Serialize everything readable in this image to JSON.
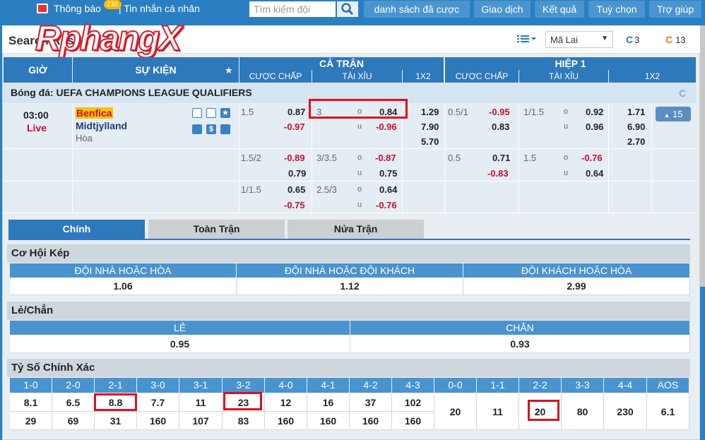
{
  "topbar": {
    "notif_label": "Thông báo",
    "notif_count": "236",
    "msg_label": "| Tin nhắn cá nhân",
    "search_placeholder": "Tìm kiếm đội",
    "buttons": [
      "danh sách đã cược",
      "Giao dịch",
      "Kết quả",
      "Tuỳ chọn",
      "Trợ giúp"
    ]
  },
  "toolbar": {
    "title": "Search Result",
    "logo": "RphangX",
    "odds_type": "Mã Lai",
    "count_a": "3",
    "count_b": "13"
  },
  "header": {
    "gio": "GIỜ",
    "su_kien": "SỰ KIỆN",
    "ca_tran": "CẢ TRẬN",
    "hiep1": "HIỆP 1",
    "cuoc_chap": "CƯỢC CHẤP",
    "tai_xiu": "TÀI XỈU",
    "x12": "1X2"
  },
  "league": "Bóng đá: UEFA CHAMPIONS LEAGUE QUALIFIERS",
  "match": {
    "time": "03:00",
    "status": "Live",
    "home": "Benfica",
    "away": "Midtjylland",
    "draw": "Hòa",
    "more": "15"
  },
  "odds_rows": [
    {
      "hdp": "1.5",
      "hdp_h": "0.87",
      "hdp_a": "-0.97",
      "ou": "3",
      "ou_o": "0.84",
      "ou_u": "-0.96",
      "x1": "1.29",
      "x2": "7.90",
      "xx": "5.70",
      "h_hdp": "0.5/1",
      "h_hdp_h": "-0.95",
      "h_hdp_a": "0.83",
      "h_ou": "1/1.5",
      "h_ou_o": "0.92",
      "h_ou_u": "0.96",
      "h_x1": "1.71",
      "h_x2": "6.90",
      "h_xx": "2.70"
    },
    {
      "hdp": "1.5/2",
      "hdp_h": "-0.89",
      "hdp_a": "0.79",
      "ou": "3/3.5",
      "ou_o": "-0.87",
      "ou_u": "0.75",
      "h_hdp": "0.5",
      "h_hdp_h": "0.71",
      "h_hdp_a": "-0.83",
      "h_ou": "1.5",
      "h_ou_o": "-0.76",
      "h_ou_u": "0.64"
    },
    {
      "hdp": "1/1.5",
      "hdp_h": "0.65",
      "hdp_a": "-0.75",
      "ou": "2.5/3",
      "ou_o": "0.64",
      "ou_u": "-0.76"
    }
  ],
  "o_label": "o",
  "u_label": "u",
  "tabs": [
    "Chính",
    "Toàn Trận",
    "Nửa Trận"
  ],
  "double_chance": {
    "title": "Cơ Hội Kép",
    "cols": [
      "ĐỘI NHÀ HOẶC HÒA",
      "ĐỘI NHÀ HOẶC ĐỘI KHÁCH",
      "ĐỘI KHÁCH HOẶC HÒA"
    ],
    "vals": [
      "1.06",
      "1.12",
      "2.99"
    ]
  },
  "odd_even": {
    "title": "Lẻ/Chẳn",
    "cols": [
      "LẺ",
      "CHẲN"
    ],
    "vals": [
      "0.95",
      "0.93"
    ]
  },
  "correct_score": {
    "title": "Tỷ Số Chính Xác",
    "cols": [
      "1-0",
      "2-0",
      "2-1",
      "3-0",
      "3-1",
      "3-2",
      "4-0",
      "4-1",
      "4-2",
      "4-3",
      "0-0",
      "1-1",
      "2-2",
      "3-3",
      "4-4",
      "AOS"
    ],
    "home": [
      "8.1",
      "6.5",
      "8.8",
      "7.7",
      "11",
      "23",
      "12",
      "16",
      "37",
      "102"
    ],
    "away": [
      "29",
      "69",
      "31",
      "160",
      "107",
      "83",
      "160",
      "160",
      "160",
      "160"
    ],
    "draws": [
      "20",
      "11",
      "20",
      "80",
      "230",
      "6.1"
    ]
  }
}
